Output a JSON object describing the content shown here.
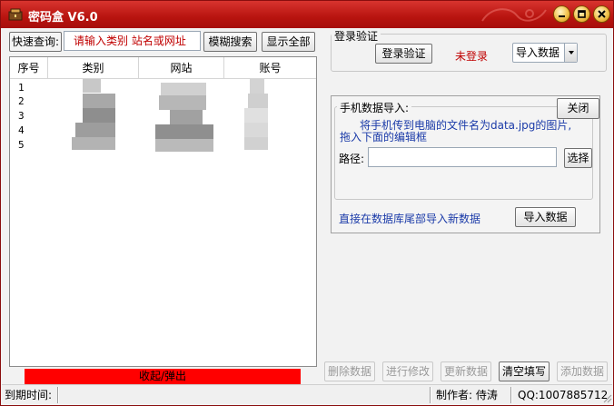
{
  "window": {
    "title": "密码盒 V6.0",
    "accent": "#c41f1a"
  },
  "search": {
    "label": "快速查询:",
    "placeholder": "请输入类别 站名或网址",
    "fuzzy_button": "模糊搜索",
    "show_all_button": "显示全部"
  },
  "table": {
    "columns": [
      "序号",
      "类别",
      "网站",
      "账号"
    ],
    "rows": [
      {
        "index": "1"
      },
      {
        "index": "2"
      },
      {
        "index": "3"
      },
      {
        "index": "4"
      },
      {
        "index": "5"
      }
    ]
  },
  "login": {
    "group_title": "登录验证",
    "login_button": "登录验证",
    "status": "未登录",
    "status_color": "#c00000",
    "import_select": "导入数据"
  },
  "phone_import": {
    "group_title": "手机数据导入:",
    "close_button": "关闭",
    "instruction_line1": "将手机传到电脑的文件名为data.jpg的图片,",
    "instruction_line2": "拖入下面的编辑框",
    "path_label": "路径:",
    "path_value": "",
    "choose_button": "选择",
    "db_import_text": "直接在数据库尾部导入新数据",
    "db_import_button": "导入数据"
  },
  "collapse_bar": {
    "label": "收起/弹出",
    "color": "#ff0000"
  },
  "actions": {
    "delete": "删除数据",
    "modify": "进行修改",
    "update": "更新数据",
    "clear": "清空填写",
    "add": "添加数据"
  },
  "status": {
    "expiry_label": "到期时间:",
    "author_label": "制作者: 侍涛",
    "qq": "QQ:1007885712"
  }
}
